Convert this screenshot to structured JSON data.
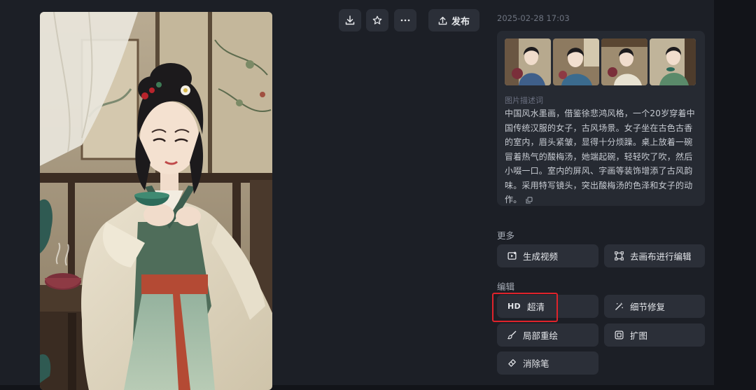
{
  "toolbar": {
    "download_icon": "download-icon",
    "favorite_icon": "star-icon",
    "more_icon": "more-dots-icon",
    "publish_label": "发布",
    "publish_icon": "upload-icon"
  },
  "info": {
    "timestamp": "2025-02-28 17:03"
  },
  "prompt": {
    "label": "图片描述词",
    "text": "中国风水墨画，借鉴徐悲鸿风格，一个20岁穿着中国传统汉服的女子，古风场景。女子坐在古色古香的室内，眉头紧皱，显得十分烦躁。桌上放着一碗冒着热气的酸梅汤，她端起碗，轻轻吹了吹，然后小啜一口。室内的屏风、字画等装饰增添了古风韵味。采用特写镜头，突出酸梅汤的色泽和女子的动作。",
    "thumbnail_count": 4
  },
  "more": {
    "title": "更多",
    "generate_video": "生成视频",
    "canvas_edit": "去画布进行编辑"
  },
  "edit": {
    "title": "编辑",
    "hd_tag": "HD",
    "super_res": "超清",
    "detail_repair": "细节修复",
    "inpaint": "局部重绘",
    "expand": "扩图",
    "eraser": "消除笔"
  },
  "colors": {
    "panel_bg": "#1c1f26",
    "card_bg": "#262a32",
    "button_bg": "#2b2f38",
    "highlight_red": "#e0232b"
  }
}
